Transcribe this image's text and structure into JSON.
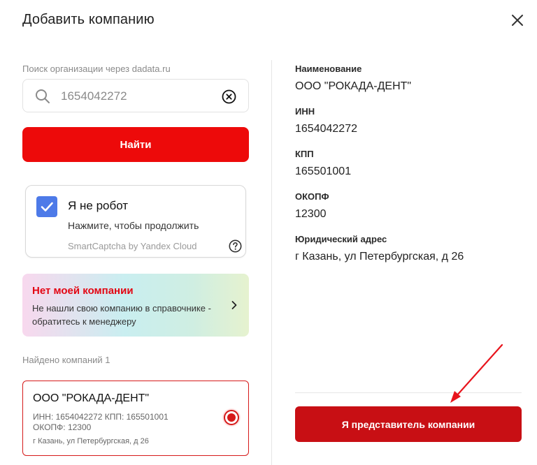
{
  "dialog": {
    "title": "Добавить компанию"
  },
  "search": {
    "label": "Поиск организации через dadata.ru",
    "value": "1654042272",
    "placeholder": "",
    "button_label": "Найти"
  },
  "captcha": {
    "title": "Я не робот",
    "subtitle": "Нажмите, чтобы продолжить",
    "brand": "SmartCaptcha by Yandex Cloud",
    "checked": true
  },
  "promo": {
    "title": "Нет моей компании",
    "text": "Не нашли свою компанию в справочнике - обратитесь к менеджеру"
  },
  "results": {
    "count_label": "Найдено компаний 1",
    "items": [
      {
        "name": "ООО \"РОКАДА-ДЕНТ\"",
        "ids_line1": "ИНН: 1654042272 КПП: 165501001",
        "ids_line2": "ОКОПФ: 12300",
        "address": "г Казань, ул Петербургская, д 26",
        "selected": true
      }
    ]
  },
  "details": {
    "name_label": "Наименование",
    "name_value": "ООО \"РОКАДА-ДЕНТ\"",
    "inn_label": "ИНН",
    "inn_value": "1654042272",
    "kpp_label": "КПП",
    "kpp_value": "165501001",
    "okopf_label": "ОКОПФ",
    "okopf_value": "12300",
    "address_label": "Юридический адрес",
    "address_value": "г Казань, ул Петербургская, д 26"
  },
  "actions": {
    "representative_label": "Я представитель компании"
  },
  "icons": {
    "close": "close-icon",
    "search": "search-icon",
    "clear": "clear-icon",
    "check": "check-icon",
    "help": "help-icon",
    "chevron": "chevron-right-icon",
    "radio": "radio-selected-icon"
  },
  "colors": {
    "primary_red": "#ed0a0a",
    "dark_red": "#c80f14",
    "checkbox_blue": "#4d7ae8",
    "promo_title_red": "#e30613"
  }
}
